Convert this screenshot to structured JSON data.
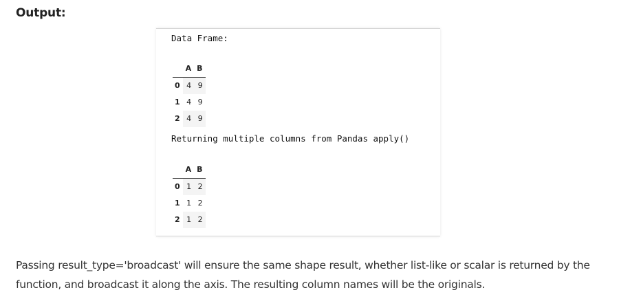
{
  "heading": "Output:",
  "output": {
    "line1": "Data Frame:",
    "table1": {
      "columns": [
        "",
        "A",
        "B"
      ],
      "rows": [
        {
          "index": "0",
          "A": "4",
          "B": "9"
        },
        {
          "index": "1",
          "A": "4",
          "B": "9"
        },
        {
          "index": "2",
          "A": "4",
          "B": "9"
        }
      ]
    },
    "line2": "Returning multiple columns from Pandas apply()",
    "table2": {
      "columns": [
        "",
        "A",
        "B"
      ],
      "rows": [
        {
          "index": "0",
          "A": "1",
          "B": "2"
        },
        {
          "index": "1",
          "A": "1",
          "B": "2"
        },
        {
          "index": "2",
          "A": "1",
          "B": "2"
        }
      ]
    }
  },
  "paragraph": "Passing result_type='broadcast' will ensure the same shape result, whether list-like or scalar is returned by the function, and broadcast it along the axis. The resulting column names will be the originals."
}
